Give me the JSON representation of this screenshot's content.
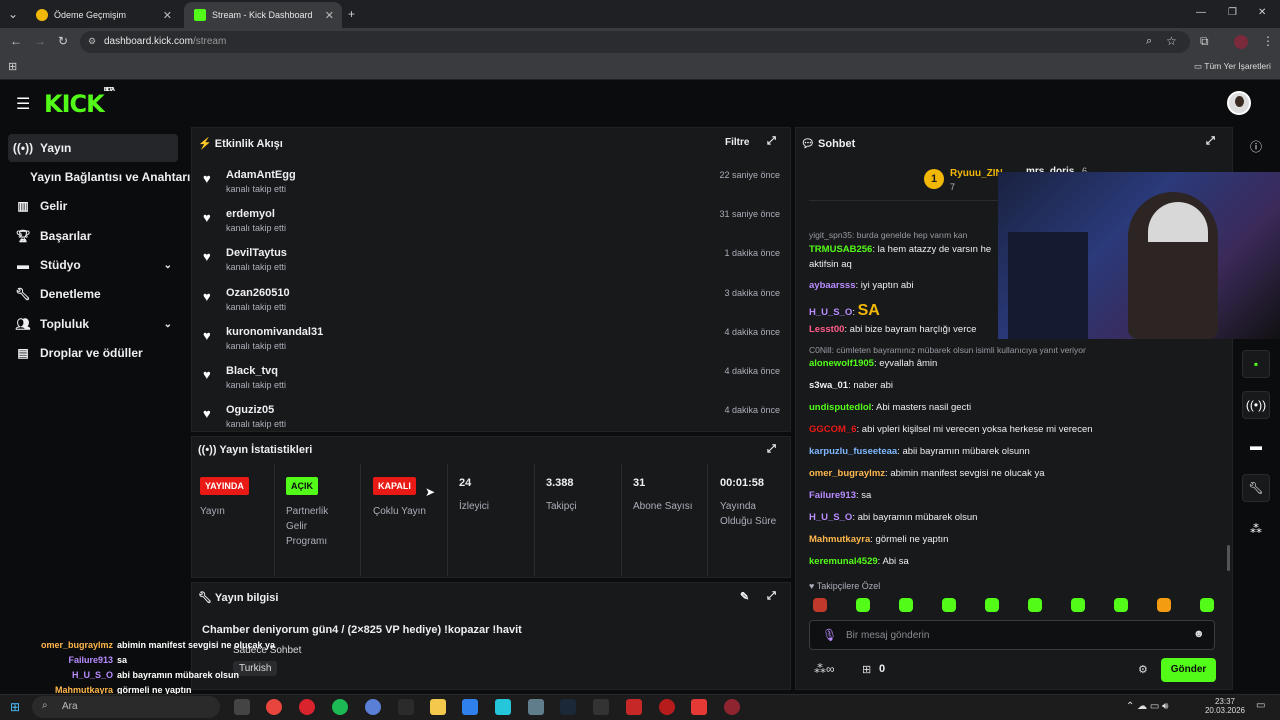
{
  "browser": {
    "tabs": [
      {
        "title": "Ödeme Geçmişim",
        "active": false
      },
      {
        "title": "Stream - Kick Dashboard",
        "active": true
      }
    ],
    "url_host": "dashboard.kick.com",
    "url_path": "/stream",
    "bookmarks_label": "Tüm Yer İşaretleri"
  },
  "brand": {
    "name": "KICK",
    "badge": "BETA",
    "accent": "#53fc18"
  },
  "sidebar": {
    "items": [
      {
        "label": "Yayın",
        "icon": "broadcast-icon"
      },
      {
        "label": "Yayın Bağlantısı ve Anahtarı",
        "icon": ""
      },
      {
        "label": "Gelir",
        "icon": "chart-icon"
      },
      {
        "label": "Başarılar",
        "icon": "trophy-icon"
      },
      {
        "label": "Stüdyo",
        "icon": "studio-icon"
      },
      {
        "label": "Denetleme",
        "icon": "wrench-icon"
      },
      {
        "label": "Topluluk",
        "icon": "people-icon"
      },
      {
        "label": "Droplar ve ödüller",
        "icon": "gift-icon"
      }
    ]
  },
  "activity": {
    "title": "Etkinlik Akışı",
    "filter": "Filtre",
    "events": [
      {
        "name": "AdamAntEgg",
        "action": "kanalı takip etti",
        "time": "22 saniye önce"
      },
      {
        "name": "erdemyol",
        "action": "kanalı takip etti",
        "time": "31 saniye önce"
      },
      {
        "name": "DevilTaytus",
        "action": "kanalı takip etti",
        "time": "1 dakika önce"
      },
      {
        "name": "Ozan260510",
        "action": "kanalı takip etti",
        "time": "3 dakika önce"
      },
      {
        "name": "kuronomivandal31",
        "action": "kanalı takip etti",
        "time": "4 dakika önce"
      },
      {
        "name": "Black_tvq",
        "action": "kanalı takip etti",
        "time": "4 dakika önce"
      },
      {
        "name": "Oguziz05",
        "action": "kanalı takip etti",
        "time": "4 dakika önce"
      }
    ]
  },
  "stats": {
    "title": "Yayın İstatistikleri",
    "items": [
      {
        "badge": "YAYINDA",
        "label": "Yayın",
        "color": "#e91916"
      },
      {
        "badge": "AÇIK",
        "label": "Partnerlik Gelir Programı",
        "color": "#53fc18"
      },
      {
        "badge": "KAPALI",
        "label": "Çoklu Yayın",
        "color": "#e91916"
      },
      {
        "value": "24",
        "label": "İzleyici"
      },
      {
        "value": "3.388",
        "label": "Takipçi"
      },
      {
        "value": "31",
        "label": "Abone Sayısı"
      },
      {
        "value": "00:01:58",
        "label": "Yayında Olduğu Süre"
      }
    ]
  },
  "info": {
    "title": "Yayın bilgisi",
    "stream_title": "Chamber deniyorum gün4 / (2×825 VP hediye) !kopazar !havit",
    "mode": "Sadece Sohbet",
    "language": "Turkish"
  },
  "chat": {
    "title": "Sohbet",
    "pinned_user": "Ryuuu_ZIN",
    "pinned_count": "7",
    "pinned_other": "mrs_doris",
    "pinned_other_count": "6",
    "rank": "1",
    "messages": [
      {
        "type": "reply",
        "text": "yigit_spn35: burda genelde hep varım kan"
      },
      {
        "user": "TRMUSAB256",
        "color": "#53fc18",
        "text": "la hem atazzy de varsın he"
      },
      {
        "user": "",
        "color": "#efeff1",
        "text": "aktifsin aq"
      },
      {
        "user": "aybaarsss",
        "color": "#b98cff",
        "text": "iyi yaptın abi"
      },
      {
        "user": "H_U_S_O",
        "color": "#b98cff",
        "text": "SA"
      },
      {
        "user": "Lesst00",
        "color": "#ff5c8a",
        "text": "abi bize bayram harçlığı verce"
      },
      {
        "type": "reply",
        "text": "C0Nill: cümleten bayramınız mübarek olsun isimli kullanıcıya yanıt veriyor"
      },
      {
        "user": "alonewolf1905",
        "color": "#53fc18",
        "text": "eyvallah âmin"
      },
      {
        "user": "s3wa_01",
        "color": "#efeff1",
        "text": "naber abi"
      },
      {
        "user": "undisputedlol",
        "color": "#53fc18",
        "text": "Abi masters nasil gecti"
      },
      {
        "user": "GGCOM_6",
        "color": "#e91916",
        "text": "abi vpleri kişilsel mi verecen yoksa herkese mi verecen"
      },
      {
        "user": "karpuzlu_fuseeteaa",
        "color": "#7fb8ff",
        "text": "abii bayramın mübarek olsunn"
      },
      {
        "user": "omer_bugraylmz",
        "color": "#ffb84d",
        "text": "abimin manifest sevgisi ne olucak ya"
      },
      {
        "user": "Failure913",
        "color": "#b98cff",
        "text": "sa"
      },
      {
        "user": "H_U_S_O",
        "color": "#b98cff",
        "text": "abi bayramın mübarek olsun"
      },
      {
        "user": "Mahmutkayra",
        "color": "#ffb84d",
        "text": "görmeli ne yaptın"
      },
      {
        "user": "keremunal4529",
        "color": "#53fc18",
        "text": "Abi sa"
      }
    ],
    "followers_only": "Takipçilere Özel",
    "input_placeholder": "Bir mesaj gönderin",
    "viewer_count": "0",
    "send": "Gönder"
  },
  "overlay": {
    "lines": [
      {
        "user": "omer_bugraylmz",
        "text": "abimin manifest sevgisi ne olucak ya",
        "color": "#ffb84d"
      },
      {
        "user": "Failure913",
        "text": "sa",
        "color": "#b98cff"
      },
      {
        "user": "H_U_S_O",
        "text": "abi bayramın mübarek olsun",
        "color": "#b98cff"
      },
      {
        "user": "Mahmutkayra",
        "text": "görmeli ne yaptın",
        "color": "#ffb84d"
      }
    ]
  },
  "taskbar": {
    "time": "23:37",
    "date": "20.03.2026",
    "search": "Ara"
  }
}
